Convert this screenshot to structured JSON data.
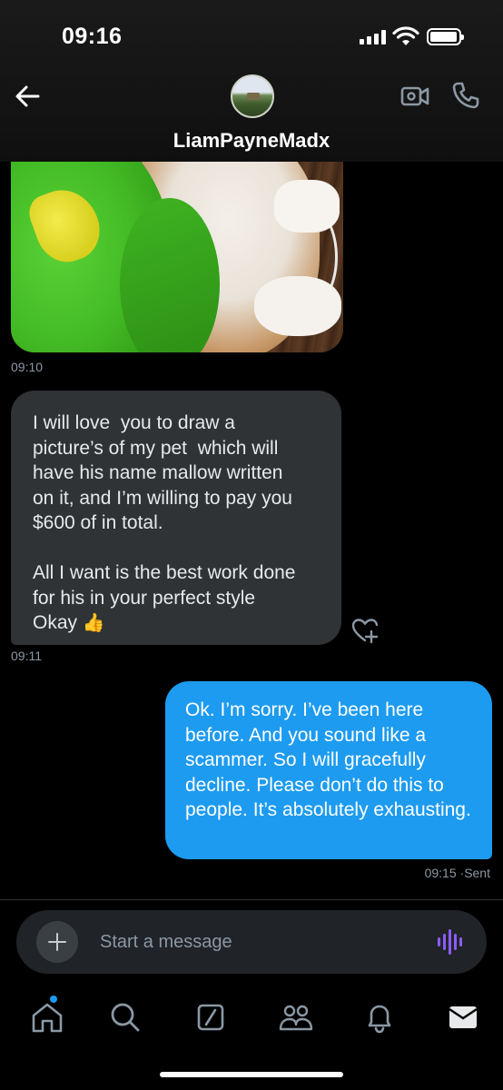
{
  "status_bar": {
    "time": "09:16"
  },
  "header": {
    "contact_name": "LiamPayneMadx"
  },
  "messages": [
    {
      "type": "image",
      "timestamp": "09:10"
    },
    {
      "type": "incoming",
      "text": "I will love  you to draw a\npicture’s of my pet  which will\nhave his name mallow written\non it, and I’m willing to pay you\n$600 of in total.\n\nAll I want is the best work done\nfor his in your perfect style\nOkay",
      "emoji": "👍",
      "timestamp": "09:11"
    },
    {
      "type": "outgoing",
      "text": "Ok. I’m sorry. I’ve been here before. And you sound like a scammer. So I will gracefully decline. Please don’t do this to people. It’s absolutely exhausting.",
      "timestamp": "09:15",
      "status": "Sent"
    }
  ],
  "composer": {
    "placeholder": "Start a message"
  },
  "colors": {
    "accent": "#1d9bf0",
    "incoming_bubble": "#2f3336",
    "voice": "#8a5cf6",
    "background": "#000000"
  },
  "tabbar": {
    "icons": [
      "home-icon",
      "search-icon",
      "grok-icon",
      "communities-icon",
      "notifications-icon",
      "messages-icon"
    ]
  }
}
